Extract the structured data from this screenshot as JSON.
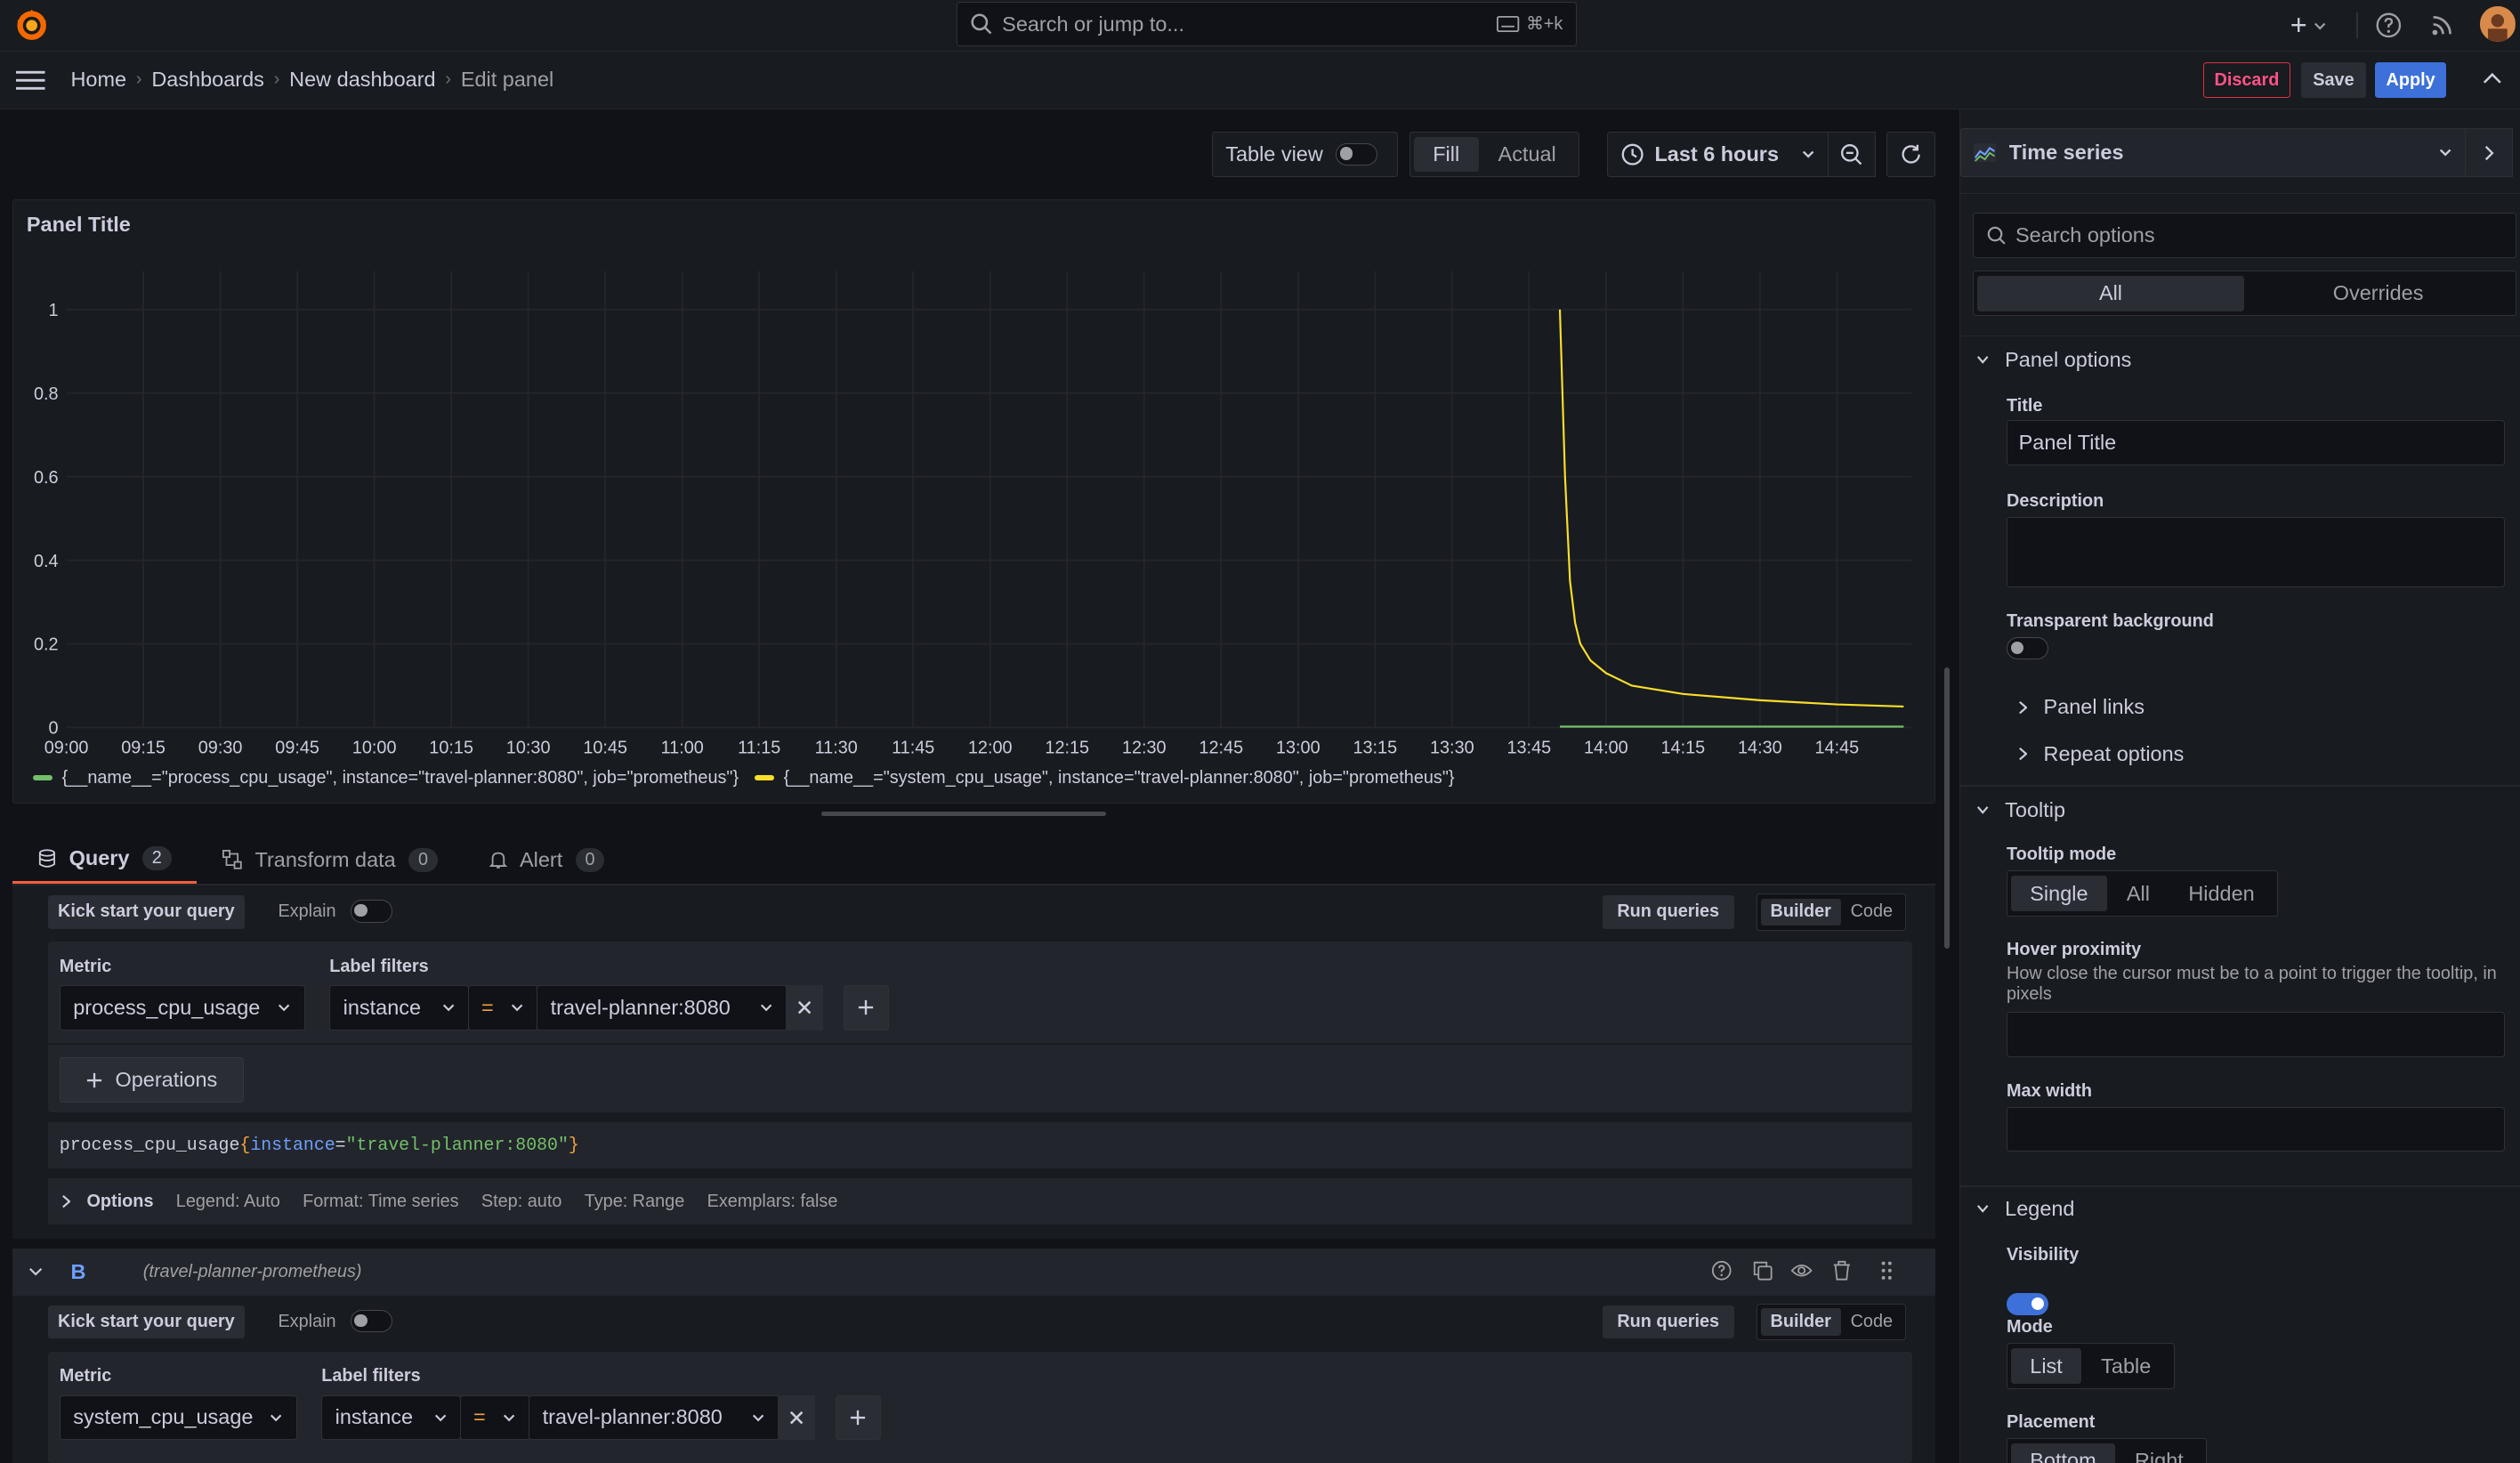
{
  "topbar": {
    "search_placeholder": "Search or jump to...",
    "shortcut": "⌘+k",
    "plus": "+"
  },
  "breadcrumb": {
    "items": [
      "Home",
      "Dashboards",
      "New dashboard"
    ],
    "current": "Edit panel"
  },
  "actions": {
    "discard": "Discard",
    "save": "Save",
    "apply": "Apply"
  },
  "toolbar": {
    "table_view": "Table view",
    "fill": "Fill",
    "actual": "Actual",
    "time_range": "Last 6 hours"
  },
  "panel": {
    "title": "Panel Title"
  },
  "chart_data": {
    "type": "line",
    "y_ticks": [
      "1",
      "0.8",
      "0.6",
      "0.4",
      "0.2",
      "0"
    ],
    "x_ticks": [
      "09:00",
      "09:15",
      "09:30",
      "09:45",
      "10:00",
      "10:15",
      "10:30",
      "10:45",
      "11:00",
      "11:15",
      "11:30",
      "11:45",
      "12:00",
      "12:15",
      "12:30",
      "12:45",
      "13:00",
      "13:15",
      "13:30",
      "13:45",
      "14:00",
      "14:15",
      "14:30",
      "14:45"
    ],
    "ylim": [
      0,
      1
    ],
    "grid": true,
    "legend_position": "bottom",
    "series": [
      {
        "name": "{__name__=\"process_cpu_usage\", instance=\"travel-planner:8080\", job=\"prometheus\"}",
        "color": "#73bf69",
        "x": [
          "13:51",
          "14:00",
          "14:15",
          "14:30",
          "14:45",
          "14:58"
        ],
        "y": [
          0.002,
          0.002,
          0.002,
          0.002,
          0.002,
          0.002
        ]
      },
      {
        "name": "{__name__=\"system_cpu_usage\", instance=\"travel-planner:8080\", job=\"prometheus\"}",
        "color": "#fade2a",
        "x": [
          "13:51",
          "13:52",
          "13:53",
          "13:54",
          "13:55",
          "13:57",
          "14:00",
          "14:05",
          "14:15",
          "14:30",
          "14:45",
          "14:58"
        ],
        "y": [
          1.0,
          0.6,
          0.35,
          0.25,
          0.2,
          0.16,
          0.13,
          0.1,
          0.08,
          0.065,
          0.055,
          0.05
        ]
      }
    ]
  },
  "tabs": [
    {
      "label": "Query",
      "count": "2"
    },
    {
      "label": "Transform data",
      "count": "0"
    },
    {
      "label": "Alert",
      "count": "0"
    }
  ],
  "queryA": {
    "kick": "Kick start your query",
    "explain": "Explain",
    "run": "Run queries",
    "builder": "Builder",
    "code": "Code",
    "metric_label": "Metric",
    "metric": "process_cpu_usage",
    "filters_label": "Label filters",
    "filter_key": "instance",
    "filter_op": "=",
    "filter_value": "travel-planner:8080",
    "operations": "Operations",
    "expr_metric": "process_cpu_usage",
    "expr_open": "{",
    "expr_key": "instance",
    "expr_eq": "=",
    "expr_val": "\"travel-planner:8080\"",
    "expr_close": "}",
    "options_label": "Options",
    "opt_legend": "Legend: Auto",
    "opt_format": "Format: Time series",
    "opt_step": "Step: auto",
    "opt_type": "Type: Range",
    "opt_exemplars": "Exemplars: false"
  },
  "queryB": {
    "letter": "B",
    "datasource": "(travel-planner-prometheus)",
    "kick": "Kick start your query",
    "explain": "Explain",
    "run": "Run queries",
    "builder": "Builder",
    "code": "Code",
    "metric_label": "Metric",
    "metric": "system_cpu_usage",
    "filters_label": "Label filters",
    "filter_key": "instance",
    "filter_op": "=",
    "filter_value": "travel-planner:8080"
  },
  "options": {
    "viz": "Time series",
    "search_placeholder": "Search options",
    "tab_all": "All",
    "tab_overrides": "Overrides",
    "panel_options": "Panel options",
    "title_label": "Title",
    "title_value": "Panel Title",
    "description_label": "Description",
    "transparent_label": "Transparent background",
    "panel_links": "Panel links",
    "repeat_options": "Repeat options",
    "tooltip": "Tooltip",
    "tooltip_mode": "Tooltip mode",
    "mode_single": "Single",
    "mode_all": "All",
    "mode_hidden": "Hidden",
    "hover_proximity": "Hover proximity",
    "hover_desc": "How close the cursor must be to a point to trigger the tooltip, in pixels",
    "max_width": "Max width",
    "legend": "Legend",
    "visibility": "Visibility",
    "mode": "Mode",
    "mode_list": "List",
    "mode_table": "Table",
    "placement": "Placement",
    "placement_bottom": "Bottom",
    "placement_right": "Right"
  }
}
